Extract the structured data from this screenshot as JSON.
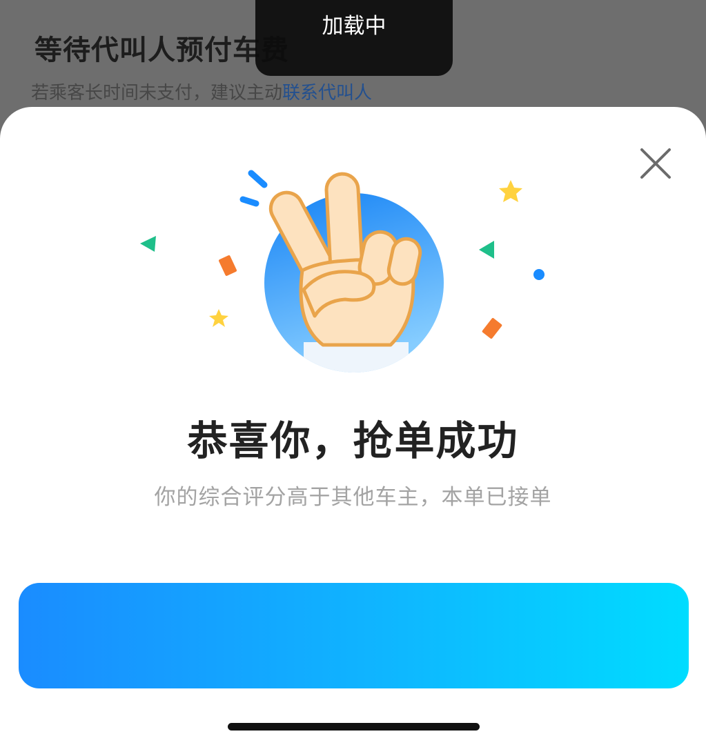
{
  "status_toast": {
    "label": "加载中"
  },
  "background": {
    "title": "等待代叫人预付车费",
    "hint_prefix": "若乘客长时间未支付，建议主动",
    "hint_link": "联系代叫人"
  },
  "modal": {
    "close_icon": "close-icon",
    "illustration_icon": "peace-hand-icon",
    "heading": "恭喜你，抢单成功",
    "message": "你的综合评分高于其他车主，本单已接单"
  },
  "colors": {
    "accent_start": "#1a8cff",
    "accent_end": "#00dcff",
    "link": "#23508f",
    "heading": "#222222",
    "message": "#a3a3a3"
  }
}
